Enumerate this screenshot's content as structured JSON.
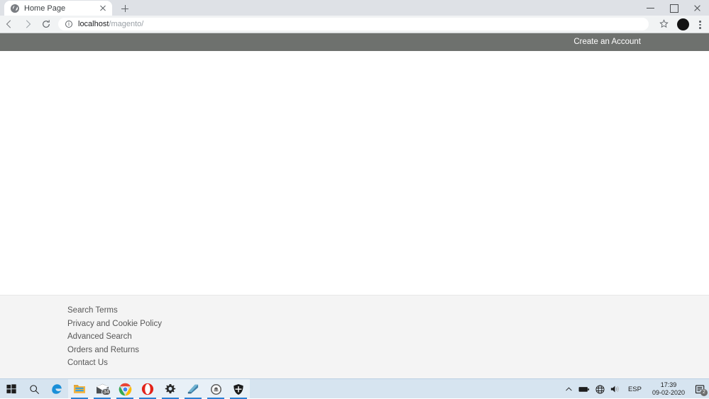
{
  "browser": {
    "tab": {
      "title": "Home Page",
      "favicon": "globe-icon"
    },
    "new_tab_label": "+",
    "window_controls": {
      "minimize": "minimize-icon",
      "maximize": "maximize-icon",
      "close": "close-icon"
    },
    "nav": {
      "back": "back-arrow-icon",
      "forward": "forward-arrow-icon",
      "reload": "reload-icon"
    },
    "omnibox": {
      "site_info": "info-icon",
      "host": "localhost",
      "path": "/magento/",
      "full_url": "localhost/magento/"
    },
    "toolbar_right": {
      "bookmark": "star-icon",
      "profile": "avatar-icon",
      "menu": "kebab-menu-icon"
    }
  },
  "page": {
    "topbar": {
      "create_account": "Create an Account"
    },
    "footer": {
      "links": [
        "Search Terms",
        "Privacy and Cookie Policy",
        "Advanced Search",
        "Orders and Returns",
        "Contact Us"
      ]
    }
  },
  "taskbar": {
    "apps": [
      {
        "name": "start-button",
        "icon": "windows-logo-icon",
        "badge": "",
        "active": false
      },
      {
        "name": "search-button",
        "icon": "search-icon",
        "badge": "",
        "active": false
      },
      {
        "name": "edge-app",
        "icon": "edge-icon",
        "badge": "",
        "active": false
      },
      {
        "name": "file-explorer-app",
        "icon": "folder-icon",
        "badge": "",
        "active": true
      },
      {
        "name": "mail-app",
        "icon": "mail-icon",
        "badge": "34",
        "active": true
      },
      {
        "name": "chrome-app",
        "icon": "chrome-icon",
        "badge": "",
        "active": true
      },
      {
        "name": "opera-app",
        "icon": "opera-icon",
        "badge": "",
        "active": true
      },
      {
        "name": "settings-app",
        "icon": "gear-icon",
        "badge": "",
        "active": true
      },
      {
        "name": "editor-app",
        "icon": "book-icon",
        "badge": "",
        "active": true
      },
      {
        "name": "browser-app",
        "icon": "circle-icon",
        "badge": "",
        "active": true
      },
      {
        "name": "security-app",
        "icon": "shield-icon",
        "badge": "",
        "active": true
      }
    ],
    "tray": {
      "overflow": "chevron-up-icon",
      "battery": "battery-icon",
      "network": "network-globe-icon",
      "volume": "speaker-icon",
      "language": "ESP",
      "time": "17:39",
      "date": "09-02-2020",
      "notifications": "notification-icon",
      "notification_count": "2"
    }
  },
  "colors": {
    "topbar_gray": "#6e716e",
    "footer_bg": "#f4f4f4",
    "tabstrip": "#dee1e6",
    "toolbar": "#f1f3f4",
    "taskbar": "#d6e4f0",
    "accent_blue": "#2a7fd4"
  }
}
